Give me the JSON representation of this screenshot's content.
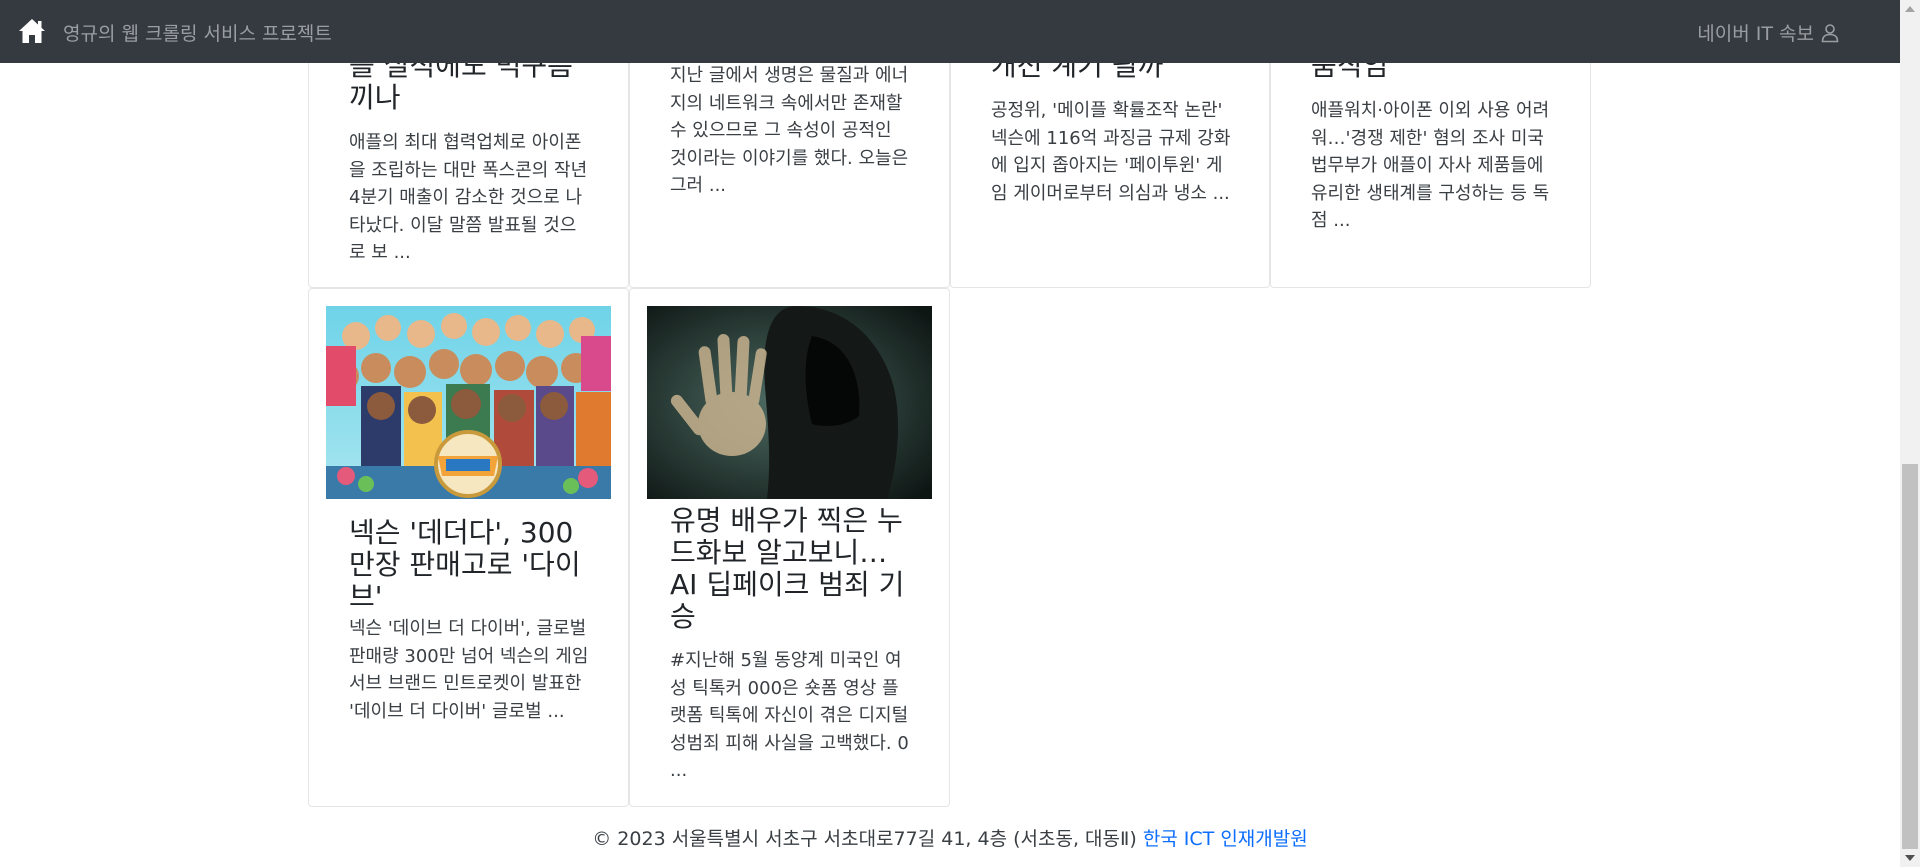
{
  "navbar": {
    "brand": "영규의 웹 크롤링 서비스 프로젝트",
    "right_link": "네이버 IT 속보",
    "home_icon": "house-icon",
    "user_icon": "person-icon"
  },
  "cards": [
    {
      "title_partial": "를 실적에도 먹구름\n끼나",
      "text": "애플의 최대 협력업체로 아이폰을 조립하는 대만 폭스콘의 작년 4분기 매출이 감소한 것으로 나타났다. 이달 말쯤 발표될 것으로 보 ..."
    },
    {
      "title_partial": "",
      "text": "지난 글에서 생명은 물질과 에너지의 네트워크 속에서만 존재할 수 있으므로 그 속성이 공적인 것이라는 이야기를 했다. 오늘은 그러 ..."
    },
    {
      "title_partial": "개선 계기 될까",
      "text": "공정위, '메이플 확률조작 논란' 넥슨에 116억 과징금 규제 강화에 입지 좁아지는 '페이투윈' 게임 게이머로부터 의심과 냉소 ..."
    },
    {
      "title_partial": "움직임",
      "text": "애플워치·아이폰 이외 사용 어려워…'경쟁 제한' 혐의 조사 미국 법무부가 애플이 자사 제품들에 유리한 생태계를 구성하는 등 독점 ..."
    },
    {
      "title": "넥슨 '데더다', 300만장 판매고로 '다이브'",
      "text": "넥슨 '데이브 더 다이버', 글로벌 판매량 300만 넘어 넥슨의 게임 서브 브랜드 민트로켓이 발표한 '데이브 더 다이버' 글로벌 ..."
    },
    {
      "title": "유명 배우가 찍은 누드화보 알고보니… AI 딥페이크 범죄 기승",
      "text": "#지난해 5월 동양계 미국인 여성 틱톡커 000은 숏폼 영상 플랫폼 틱톡에 자신이 겪은 디지털 성범죄 피해 사실을 고백했다. 0 ..."
    }
  ],
  "footer": {
    "text": "© 2023 서울특별시 서초구 서초대로77길 41, 4층 (서초동, 대동Ⅱ)",
    "link": "한국 ICT 인재개발원"
  }
}
